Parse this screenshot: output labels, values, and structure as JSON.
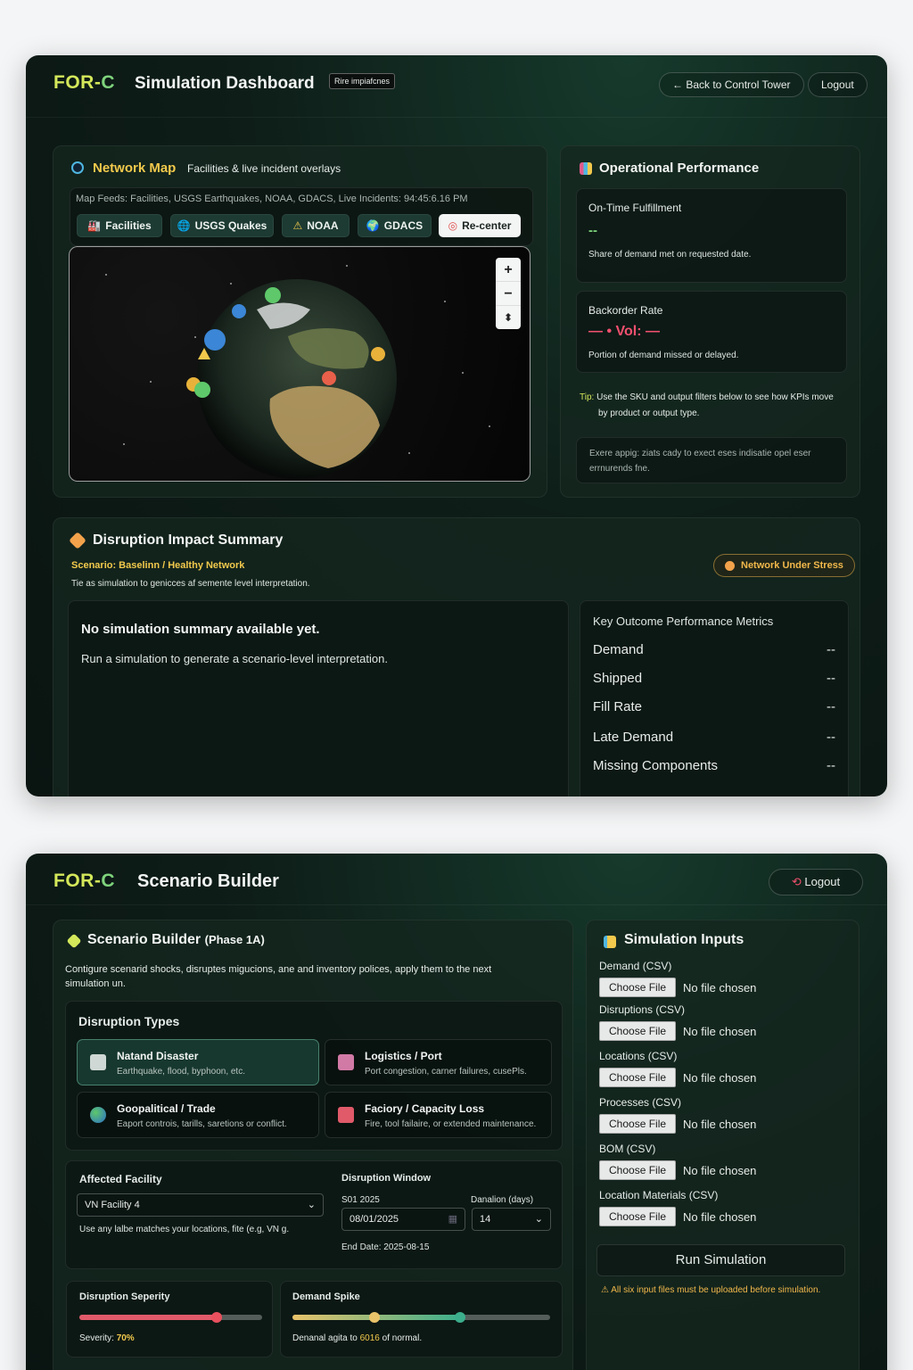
{
  "dashboard": {
    "brand_a": "FOR-",
    "brand_b": "C",
    "title": "Simulation Dashboard",
    "tag": "Rire impiafcnes",
    "back_button": "← Back to Control Tower",
    "logout_button": "Logout",
    "network_map": {
      "title": "Network Map",
      "subtitle": "Facilities & live incident overlays",
      "feeds": "Map Feeds: Facilities, USGS Earthquakes, NOAA, GDACS, Live Incidents: 94:45:6.16 PM",
      "chips": [
        "Facilities",
        "USGS Quakes",
        "NOAA",
        "GDACS",
        "Re-center"
      ],
      "zoom_in": "+",
      "zoom_out": "−",
      "compass": "⬍"
    },
    "operational": {
      "title": "Operational Performance",
      "on_time_label": "On-Time Fulfillment",
      "on_time_value": "--",
      "on_time_desc": "Share of demand met on requested date.",
      "backorder_label": "Backorder Rate",
      "backorder_value": "— • Vol: —",
      "backorder_desc": "Portion of demand missed or delayed.",
      "tip_prefix": "Tip:",
      "tip_text": "Use the SKU and output filters below to see how KPIs move",
      "tip_text2": "by product or output type.",
      "note_line1": "Exere appig: ziats cady to exect eses indisatie opel eser",
      "note_line2": "errnurends fne."
    },
    "disruption": {
      "title": "Disruption Impact Summary",
      "scenario": "Scenario: Baselinn / Healthy Network",
      "description": "Tie as simulation to genicces af semente level interpretation.",
      "status_badge": "Network Under Stress",
      "empty_title": "No simulation summary available yet.",
      "empty_desc": "Run a simulation to generate a scenario-level interpretation.",
      "metrics_title": "Key Outcome Performance Metrics",
      "metrics": [
        {
          "label": "Demand",
          "value": "--"
        },
        {
          "label": "Shipped",
          "value": "--"
        },
        {
          "label": "Fill Rate",
          "value": "--"
        },
        {
          "label": "Late Demand",
          "value": "--"
        },
        {
          "label": "Missing Components",
          "value": "--"
        }
      ]
    }
  },
  "builder": {
    "brand_a": "FOR-",
    "brand_b": "C",
    "title": "Scenario Builder",
    "logout_button": "Logout",
    "panel_title": "Scenario Builder",
    "panel_phase": "(Phase 1A)",
    "intro_line1": "Contigure scenarid shocks, disruptes migucions, ane and inventory polices, apply them to the next",
    "intro_line2": "simulation un.",
    "types_title": "Disruption Types",
    "types": [
      {
        "name": "Natand Disaster",
        "desc": "Earthquake, flood, byphoon, etc."
      },
      {
        "name": "Logistics / Port",
        "desc": "Port congestion, carner failures, cusePls."
      },
      {
        "name": "Goopalitical / Trade",
        "desc": "Eaport controis, tarills, saretions or conflict."
      },
      {
        "name": "Faciory / Capacity Loss",
        "desc": "Fire, tool failaire, or extended maintenance."
      }
    ],
    "facility_label": "Affected Facility",
    "facility_value": "VN Facility 4",
    "facility_hint": "Use any lalbe matches your locations, fite (e.g, VN g.",
    "window_label": "Disruption Window",
    "start_label": "S01 2025",
    "start_value": "08/01/2025",
    "duration_label": "Danalion (days)",
    "duration_value": "14",
    "end_date": "End Date: 2025-08-15",
    "severity_label": "Disruption Seperity",
    "severity_text": "Severity:",
    "severity_value": "70%",
    "severity_pct": 0.75,
    "spike_label": "Demand Spike",
    "spike_text": "Denanal agita to",
    "spike_value": "6016",
    "spike_suffix": "of normal.",
    "spike_pct_a": 0.32,
    "spike_pct_b": 0.65,
    "inputs_title": "Simulation Inputs",
    "inputs": [
      {
        "label": "Demand (CSV)",
        "button": "Choose File",
        "status": "No file chosen"
      },
      {
        "label": "Disruptions (CSV)",
        "button": "Choose File",
        "status": "No file chosen"
      },
      {
        "label": "Locations (CSV)",
        "button": "Choose File",
        "status": "No file chosen"
      },
      {
        "label": "Processes (CSV)",
        "button": "Choose File",
        "status": "No file chosen"
      },
      {
        "label": "BOM (CSV)",
        "button": "Choose File",
        "status": "No file chosen"
      },
      {
        "label": "Location Materials (CSV)",
        "button": "Choose File",
        "status": "No file chosen"
      }
    ],
    "run_button": "Run Simulation",
    "warning": "All six input files must be uploaded before simulation."
  },
  "colors": {
    "accent_yellow": "#d4e85a",
    "accent_green": "#7fd37c",
    "alert_red": "#f0506e",
    "warning_amber": "#f2b84b"
  },
  "icons": {
    "map": "globe-icon",
    "perf": "bar-chart-icon",
    "disruption": "diamond-icon",
    "inputs": "folder-icon"
  }
}
